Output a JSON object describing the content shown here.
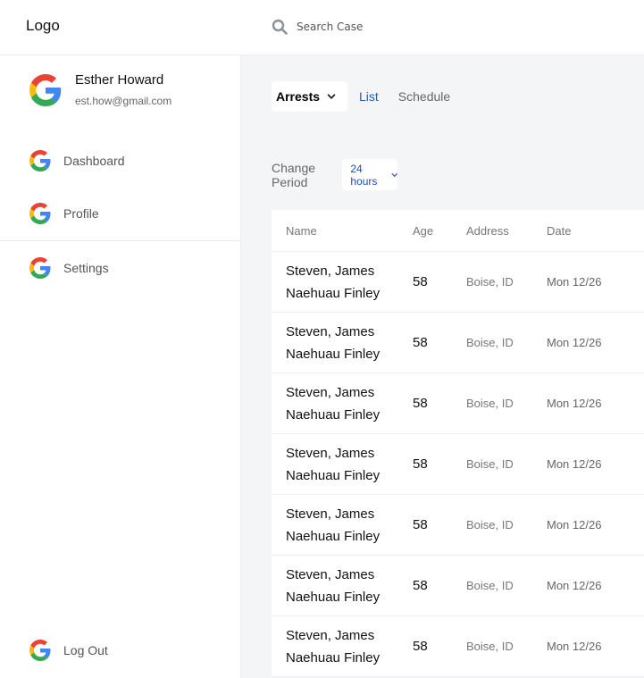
{
  "header": {
    "logo": "Logo",
    "search_placeholder": "Search Case"
  },
  "user": {
    "name": "Esther Howard",
    "email": "est.how@gmail.com"
  },
  "sidebar": {
    "items": [
      {
        "label": "Dashboard",
        "icon": "google-icon"
      },
      {
        "label": "Profile",
        "icon": "google-icon"
      },
      {
        "label": "Settings",
        "icon": "google-icon"
      }
    ],
    "logout": "Log Out"
  },
  "tabs": {
    "dropdown": "Arrests",
    "list": "List",
    "schedule": "Schedule"
  },
  "period": {
    "label": "Change Period",
    "value": "24 hours"
  },
  "table": {
    "headers": [
      "Name",
      "Age",
      "Address",
      "Date"
    ],
    "rows": [
      {
        "name_line1": "Steven, James",
        "name_line2": "Naehuau Finley",
        "age": "58",
        "address": "Boise, ID",
        "date": "Mon 12/26"
      },
      {
        "name_line1": "Steven, James",
        "name_line2": "Naehuau Finley",
        "age": "58",
        "address": "Boise, ID",
        "date": "Mon 12/26"
      },
      {
        "name_line1": "Steven, James",
        "name_line2": "Naehuau Finley",
        "age": "58",
        "address": "Boise, ID",
        "date": "Mon 12/26"
      },
      {
        "name_line1": "Steven, James",
        "name_line2": "Naehuau Finley",
        "age": "58",
        "address": "Boise, ID",
        "date": "Mon 12/26"
      },
      {
        "name_line1": "Steven, James",
        "name_line2": "Naehuau Finley",
        "age": "58",
        "address": "Boise, ID",
        "date": "Mon 12/26"
      },
      {
        "name_line1": "Steven, James",
        "name_line2": "Naehuau Finley",
        "age": "58",
        "address": "Boise, ID",
        "date": "Mon 12/26"
      },
      {
        "name_line1": "Steven, James",
        "name_line2": "Naehuau Finley",
        "age": "58",
        "address": "Boise, ID",
        "date": "Mon 12/26"
      }
    ]
  },
  "colors": {
    "accent": "#1b5fd1",
    "background": "#f4f5f7",
    "google_blue": "#4285F4",
    "google_red": "#EA4335",
    "google_yellow": "#FBBC05",
    "google_green": "#34A853"
  }
}
